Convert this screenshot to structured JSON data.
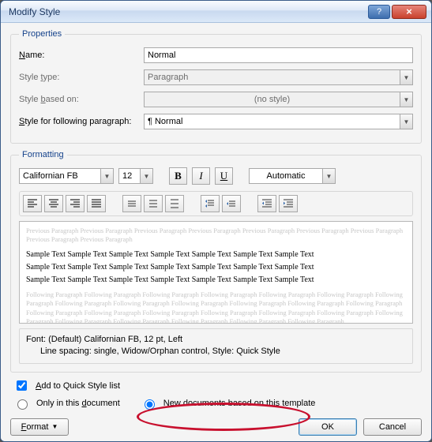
{
  "window": {
    "title": "Modify Style"
  },
  "properties": {
    "legend": "Properties",
    "name_label": "Name:",
    "name_value": "Normal",
    "type_label": "Style type:",
    "type_value": "Paragraph",
    "based_label": "Style based on:",
    "based_value": "(no style)",
    "following_label": "Style for following paragraph:",
    "following_value": "¶ Normal"
  },
  "formatting": {
    "legend": "Formatting",
    "font": "Californian FB",
    "size": "12",
    "color": "Automatic"
  },
  "preview": {
    "prev_text": "Previous Paragraph Previous Paragraph Previous Paragraph Previous Paragraph Previous Paragraph Previous Paragraph Previous Paragraph Previous Paragraph Previous Paragraph",
    "sample1": "Sample Text Sample Text Sample Text Sample Text Sample Text Sample Text Sample Text",
    "sample2": "Sample Text Sample Text Sample Text Sample Text Sample Text Sample Text Sample Text",
    "sample3": "Sample Text Sample Text Sample Text Sample Text Sample Text Sample Text Sample Text",
    "foll_text": "Following Paragraph Following Paragraph Following Paragraph Following Paragraph Following Paragraph Following Paragraph Following Paragraph Following Paragraph Following Paragraph Following Paragraph Following Paragraph Following Paragraph Following Paragraph Following Paragraph Following Paragraph Following Paragraph Following Paragraph Following Paragraph Following Paragraph Following Paragraph Following Paragraph Following Paragraph Following Paragraph Following Paragraph Following Paragraph"
  },
  "description": {
    "line1": "Font: (Default) Californian FB, 12 pt, Left",
    "line2": "Line spacing:  single, Widow/Orphan control, Style: Quick Style"
  },
  "options": {
    "quickstyle": "Add to Quick Style list",
    "only_doc": "Only in this document",
    "new_docs": "New documents based on this template"
  },
  "buttons": {
    "format": "Format",
    "ok": "OK",
    "cancel": "Cancel"
  }
}
